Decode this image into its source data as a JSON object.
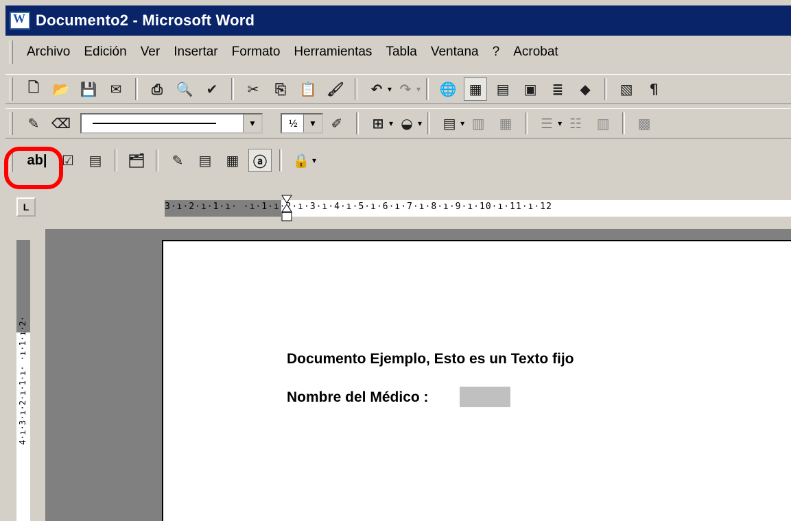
{
  "window": {
    "title": "Documento2 - Microsoft Word"
  },
  "menu": [
    {
      "label": "Archivo"
    },
    {
      "label": "Edición"
    },
    {
      "label": "Ver"
    },
    {
      "label": "Insertar"
    },
    {
      "label": "Formato"
    },
    {
      "label": "Herramientas"
    },
    {
      "label": "Tabla"
    },
    {
      "label": "Ventana"
    },
    {
      "label": "?"
    },
    {
      "label": "Acrobat"
    }
  ],
  "toolbar": {
    "line_weight": "½",
    "textfield_button": "ab|"
  },
  "ruler": {
    "tab_marker": "L",
    "horizontal": "3·ı·2·ı·1·ı·  ·ı·1·ı·2·ı·3·ı·4·ı·5·ı·6·ı·7·ı·8·ı·9·ı·10·ı·11·ı·12",
    "vertical": "4·ı·3·ı·2·ı·1·ı·  ·ı·1·ı·2·"
  },
  "document": {
    "line1": "Documento Ejemplo, Esto es un Texto fijo",
    "line2_label": "Nombre del Médico :"
  },
  "colors": {
    "titlebar": "#0a246a",
    "highlight": "#ff0000",
    "field": "#c0c0c0"
  }
}
